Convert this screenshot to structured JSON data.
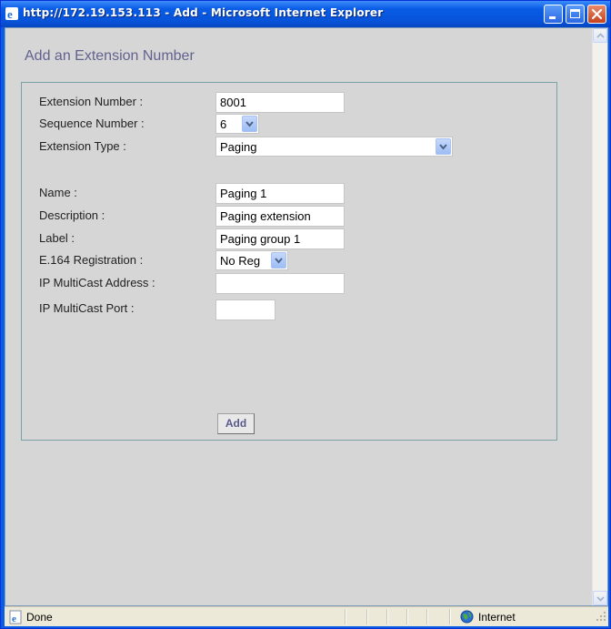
{
  "window": {
    "title": "http://172.19.153.113 - Add - Microsoft Internet Explorer"
  },
  "page": {
    "title": "Add an Extension Number"
  },
  "form": {
    "extension_number": {
      "label": "Extension Number :",
      "value": "8001"
    },
    "sequence_number": {
      "label": "Sequence Number :",
      "value": "6"
    },
    "extension_type": {
      "label": "Extension Type :",
      "value": "Paging"
    },
    "name": {
      "label": "Name :",
      "value": "Paging 1"
    },
    "description": {
      "label": "Description :",
      "value": "Paging extension"
    },
    "label_field": {
      "label": "Label :",
      "value": "Paging group 1"
    },
    "e164_registration": {
      "label": "E.164 Registration :",
      "value": "No Reg"
    },
    "ip_multicast_address": {
      "label": "IP MultiCast Address :",
      "value": ""
    },
    "ip_multicast_port": {
      "label": "IP MultiCast Port :",
      "value": ""
    },
    "add_button": "Add"
  },
  "statusbar": {
    "status": "Done",
    "zone": "Internet"
  },
  "icons": {
    "title_icon": "ie-icon",
    "status_icon": "page-done-icon",
    "zone_icon": "internet-globe-icon"
  },
  "colors": {
    "title_bar": "#0a5ce5",
    "page_title": "#62628f",
    "form_border": "#7aa2a6",
    "content_bg": "#d6d6d6"
  }
}
